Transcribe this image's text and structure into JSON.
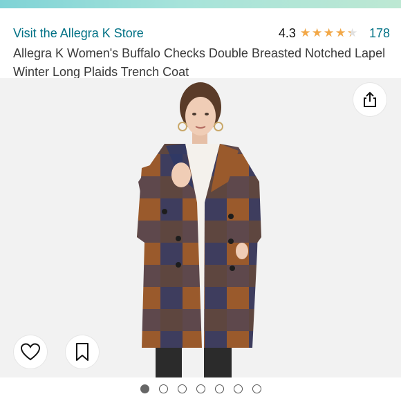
{
  "header": {
    "store_link": "Visit the Allegra K Store",
    "rating_value": "4.3",
    "rating_fraction": 0.86,
    "rating_count": "178",
    "title": "Allegra K Women's Buffalo Checks Double Breasted Notched Lapel Winter Long Plaids Trench Coat"
  },
  "image": {
    "subject": "model wearing a brown and navy buffalo check double breasted coat",
    "colors": {
      "brown": "#9a5a2c",
      "navy": "#2e3866",
      "background": "#f2f2f2"
    }
  },
  "actions": {
    "share_icon": "share-icon",
    "wishlist_icon": "heart-icon",
    "save_icon": "bookmark-icon"
  },
  "carousel": {
    "total": 7,
    "active_index": 0
  },
  "colors": {
    "link": "#007185",
    "star": "#f3a847",
    "top_bar": "#a6e3da"
  }
}
